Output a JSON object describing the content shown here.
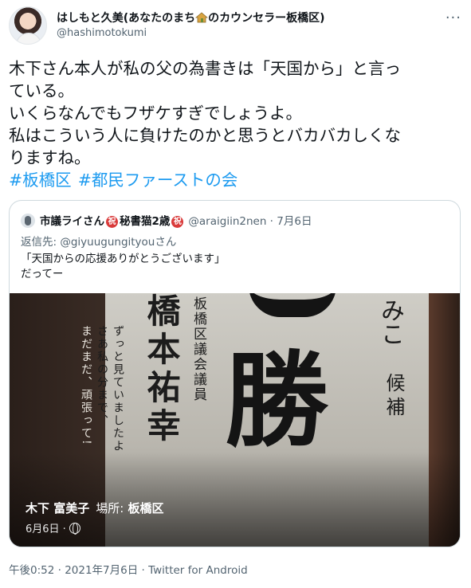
{
  "author": {
    "display_name_prefix": "はしもと久美(あなたのまち",
    "display_name_suffix": "のカウンセラー板橋区)",
    "handle": "@hashimotokumi"
  },
  "more_icon": "more-dots-icon",
  "tweet": {
    "lines": [
      "木下さん本人が私の父の為書きは「天国から」と言っ",
      "ている。",
      "いくらなんでもフザケすぎでしょうよ。",
      "私はこういう人に負けたのかと思うとバカバカしくな",
      "りますね。"
    ],
    "hashtags": [
      "#板橋区",
      "#都民ファーストの会"
    ]
  },
  "quote": {
    "name_part1": "市議ライさん",
    "badge1": "祝",
    "name_part2": "秘書猫2歳",
    "badge2": "祝",
    "handle_date": "@araigiin2nen · 7月6日",
    "reply_label": "返信先: ",
    "reply_to": "@giyuugungityouさん",
    "text_lines": [
      "「天国からの応援ありがとうございます」",
      "だってー"
    ]
  },
  "photo": {
    "poster_big1": "勝",
    "poster_name": "橋本祐幸",
    "poster_title": "板橋区議会議員",
    "poster_msg1": "ずっと見ていましたよ",
    "poster_msg2": "さあ私の分まで、",
    "poster_msg3": "まだまだ、頑張って!",
    "poster_right1": "みこ",
    "poster_right2": "候補",
    "caption_name": "木下 富美子",
    "caption_loc_label": "場所:",
    "caption_loc": "板橋区",
    "date": "6月6日 ·"
  },
  "meta": {
    "timestamp": "午後0:52 · 2021年7月6日 · Twitter for Android"
  }
}
